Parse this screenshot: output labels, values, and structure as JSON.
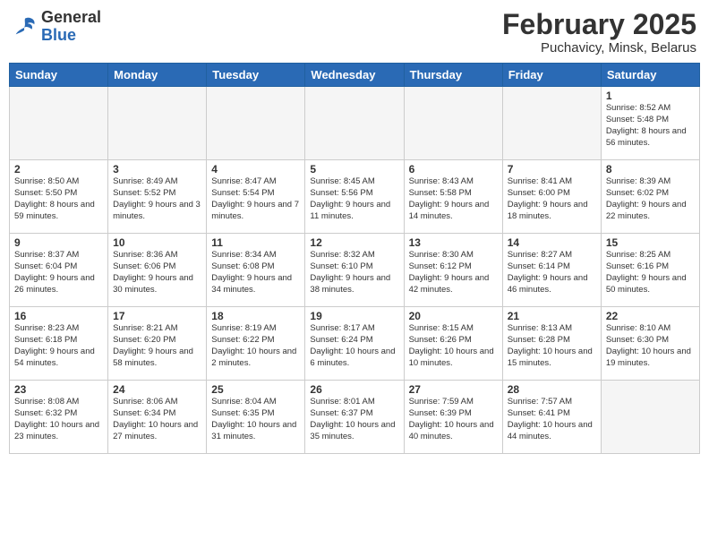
{
  "header": {
    "logo_general": "General",
    "logo_blue": "Blue",
    "title": "February 2025",
    "subtitle": "Puchavicy, Minsk, Belarus"
  },
  "weekdays": [
    "Sunday",
    "Monday",
    "Tuesday",
    "Wednesday",
    "Thursday",
    "Friday",
    "Saturday"
  ],
  "weeks": [
    [
      {
        "day": "",
        "info": ""
      },
      {
        "day": "",
        "info": ""
      },
      {
        "day": "",
        "info": ""
      },
      {
        "day": "",
        "info": ""
      },
      {
        "day": "",
        "info": ""
      },
      {
        "day": "",
        "info": ""
      },
      {
        "day": "1",
        "info": "Sunrise: 8:52 AM\nSunset: 5:48 PM\nDaylight: 8 hours and 56 minutes."
      }
    ],
    [
      {
        "day": "2",
        "info": "Sunrise: 8:50 AM\nSunset: 5:50 PM\nDaylight: 8 hours and 59 minutes."
      },
      {
        "day": "3",
        "info": "Sunrise: 8:49 AM\nSunset: 5:52 PM\nDaylight: 9 hours and 3 minutes."
      },
      {
        "day": "4",
        "info": "Sunrise: 8:47 AM\nSunset: 5:54 PM\nDaylight: 9 hours and 7 minutes."
      },
      {
        "day": "5",
        "info": "Sunrise: 8:45 AM\nSunset: 5:56 PM\nDaylight: 9 hours and 11 minutes."
      },
      {
        "day": "6",
        "info": "Sunrise: 8:43 AM\nSunset: 5:58 PM\nDaylight: 9 hours and 14 minutes."
      },
      {
        "day": "7",
        "info": "Sunrise: 8:41 AM\nSunset: 6:00 PM\nDaylight: 9 hours and 18 minutes."
      },
      {
        "day": "8",
        "info": "Sunrise: 8:39 AM\nSunset: 6:02 PM\nDaylight: 9 hours and 22 minutes."
      }
    ],
    [
      {
        "day": "9",
        "info": "Sunrise: 8:37 AM\nSunset: 6:04 PM\nDaylight: 9 hours and 26 minutes."
      },
      {
        "day": "10",
        "info": "Sunrise: 8:36 AM\nSunset: 6:06 PM\nDaylight: 9 hours and 30 minutes."
      },
      {
        "day": "11",
        "info": "Sunrise: 8:34 AM\nSunset: 6:08 PM\nDaylight: 9 hours and 34 minutes."
      },
      {
        "day": "12",
        "info": "Sunrise: 8:32 AM\nSunset: 6:10 PM\nDaylight: 9 hours and 38 minutes."
      },
      {
        "day": "13",
        "info": "Sunrise: 8:30 AM\nSunset: 6:12 PM\nDaylight: 9 hours and 42 minutes."
      },
      {
        "day": "14",
        "info": "Sunrise: 8:27 AM\nSunset: 6:14 PM\nDaylight: 9 hours and 46 minutes."
      },
      {
        "day": "15",
        "info": "Sunrise: 8:25 AM\nSunset: 6:16 PM\nDaylight: 9 hours and 50 minutes."
      }
    ],
    [
      {
        "day": "16",
        "info": "Sunrise: 8:23 AM\nSunset: 6:18 PM\nDaylight: 9 hours and 54 minutes."
      },
      {
        "day": "17",
        "info": "Sunrise: 8:21 AM\nSunset: 6:20 PM\nDaylight: 9 hours and 58 minutes."
      },
      {
        "day": "18",
        "info": "Sunrise: 8:19 AM\nSunset: 6:22 PM\nDaylight: 10 hours and 2 minutes."
      },
      {
        "day": "19",
        "info": "Sunrise: 8:17 AM\nSunset: 6:24 PM\nDaylight: 10 hours and 6 minutes."
      },
      {
        "day": "20",
        "info": "Sunrise: 8:15 AM\nSunset: 6:26 PM\nDaylight: 10 hours and 10 minutes."
      },
      {
        "day": "21",
        "info": "Sunrise: 8:13 AM\nSunset: 6:28 PM\nDaylight: 10 hours and 15 minutes."
      },
      {
        "day": "22",
        "info": "Sunrise: 8:10 AM\nSunset: 6:30 PM\nDaylight: 10 hours and 19 minutes."
      }
    ],
    [
      {
        "day": "23",
        "info": "Sunrise: 8:08 AM\nSunset: 6:32 PM\nDaylight: 10 hours and 23 minutes."
      },
      {
        "day": "24",
        "info": "Sunrise: 8:06 AM\nSunset: 6:34 PM\nDaylight: 10 hours and 27 minutes."
      },
      {
        "day": "25",
        "info": "Sunrise: 8:04 AM\nSunset: 6:35 PM\nDaylight: 10 hours and 31 minutes."
      },
      {
        "day": "26",
        "info": "Sunrise: 8:01 AM\nSunset: 6:37 PM\nDaylight: 10 hours and 35 minutes."
      },
      {
        "day": "27",
        "info": "Sunrise: 7:59 AM\nSunset: 6:39 PM\nDaylight: 10 hours and 40 minutes."
      },
      {
        "day": "28",
        "info": "Sunrise: 7:57 AM\nSunset: 6:41 PM\nDaylight: 10 hours and 44 minutes."
      },
      {
        "day": "",
        "info": ""
      }
    ]
  ]
}
